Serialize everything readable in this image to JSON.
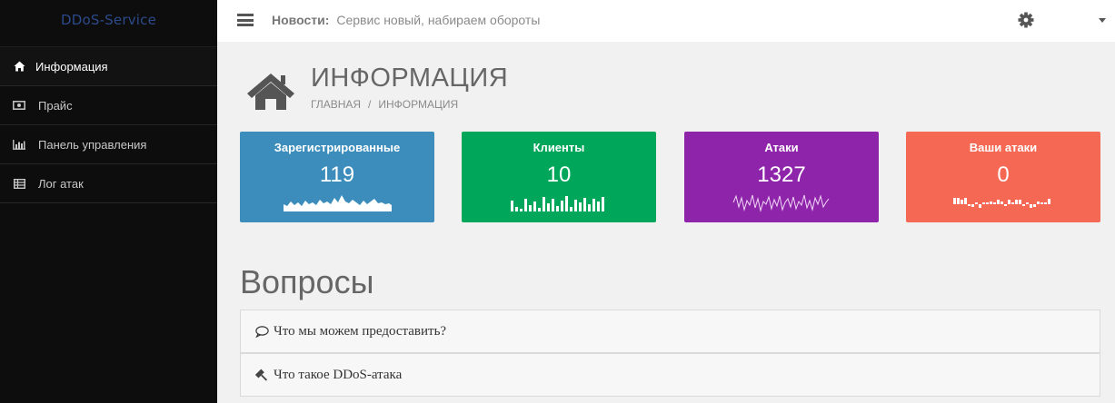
{
  "app": {
    "brand": "DDoS-Service"
  },
  "topbar": {
    "news_label": "Новости:",
    "news_text": "Сервис новый, набираем обороты"
  },
  "sidebar": {
    "items": [
      {
        "label": "Информация",
        "icon": "home-icon",
        "active": true
      },
      {
        "label": "Прайс",
        "icon": "money-icon"
      },
      {
        "label": "Панель управления",
        "icon": "bar-chart-icon"
      },
      {
        "label": "Лог атак",
        "icon": "table-icon"
      }
    ]
  },
  "header": {
    "title": "ИНФОРМАЦИЯ",
    "breadcrumb": [
      "ГЛАВНАЯ",
      "/",
      "ИНФОРМАЦИЯ"
    ]
  },
  "stats": [
    {
      "title": "Зарегистрированные",
      "value": "119",
      "color": "#3c8dbc",
      "spark_type": "area"
    },
    {
      "title": "Клиенты",
      "value": "10",
      "color": "#00a65a",
      "spark_type": "bar"
    },
    {
      "title": "Атаки",
      "value": "1327",
      "color": "#8e24aa",
      "spark_type": "line"
    },
    {
      "title": "Ваши атаки",
      "value": "0",
      "color": "#f56954",
      "spark_type": "tristate"
    }
  ],
  "questions": {
    "heading": "Вопросы",
    "items": [
      {
        "text": "Что мы можем предоставить?",
        "icon": "comment-icon"
      },
      {
        "text": "Что такое DDoS-атака",
        "icon": "gavel-icon"
      }
    ]
  }
}
